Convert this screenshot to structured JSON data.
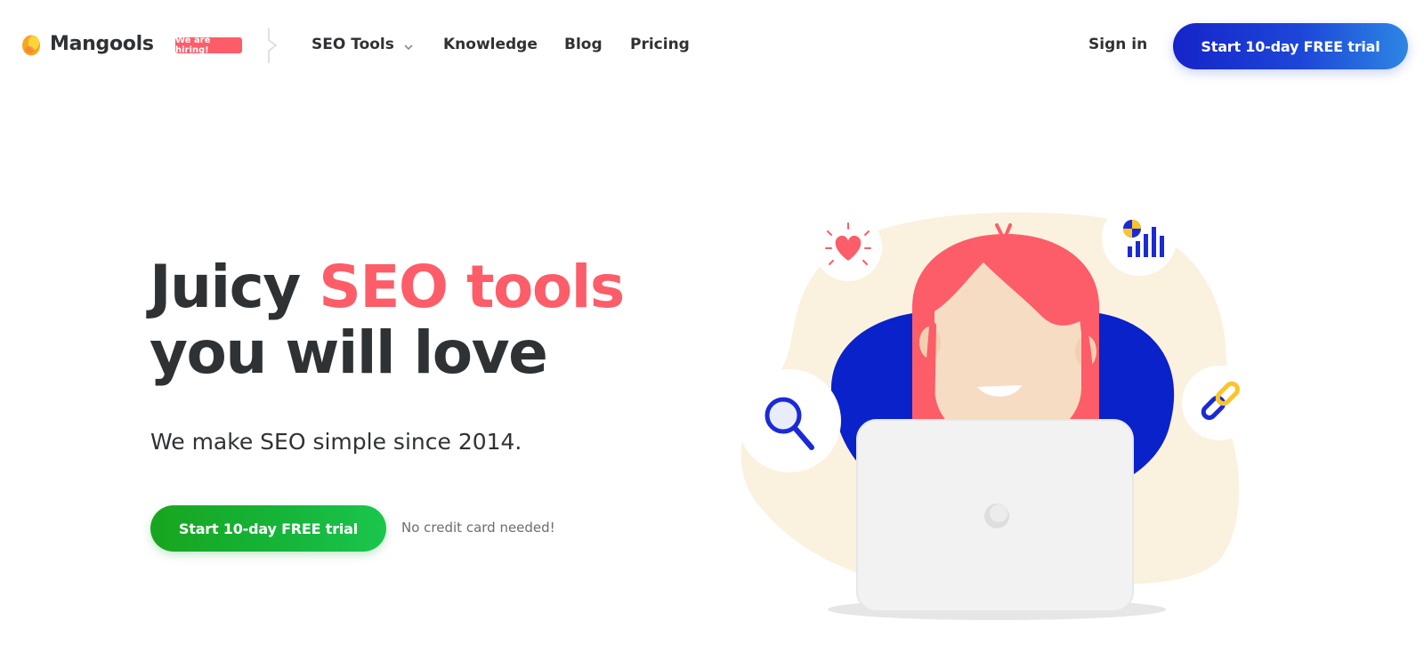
{
  "brand": {
    "name": "Mangools",
    "hiring_badge": "We are hiring!",
    "logo_color": "#f6a623"
  },
  "nav": {
    "items": [
      {
        "label": "SEO Tools",
        "has_dropdown": true,
        "icon": "chevron-down-icon"
      },
      {
        "label": "Knowledge"
      },
      {
        "label": "Blog"
      },
      {
        "label": "Pricing"
      }
    ],
    "sign_in": "Sign in",
    "cta": "Start 10-day FREE trial"
  },
  "hero": {
    "title_line1_plain": "Juicy ",
    "title_line1_highlight": "SEO tools",
    "title_line2": "you will love",
    "subtitle": "We make SEO simple since 2014.",
    "cta": "Start 10-day FREE trial",
    "note": "No credit card needed!"
  },
  "illustration": {
    "icons": [
      "heart-icon",
      "chart-icon",
      "magnifier-icon",
      "link-icon",
      "laptop-icon"
    ]
  },
  "colors": {
    "accent_red": "#fc5d69",
    "cta_blue": "#1d47d8",
    "cta_green": "#15b63b",
    "text_dark": "#2f3235"
  }
}
